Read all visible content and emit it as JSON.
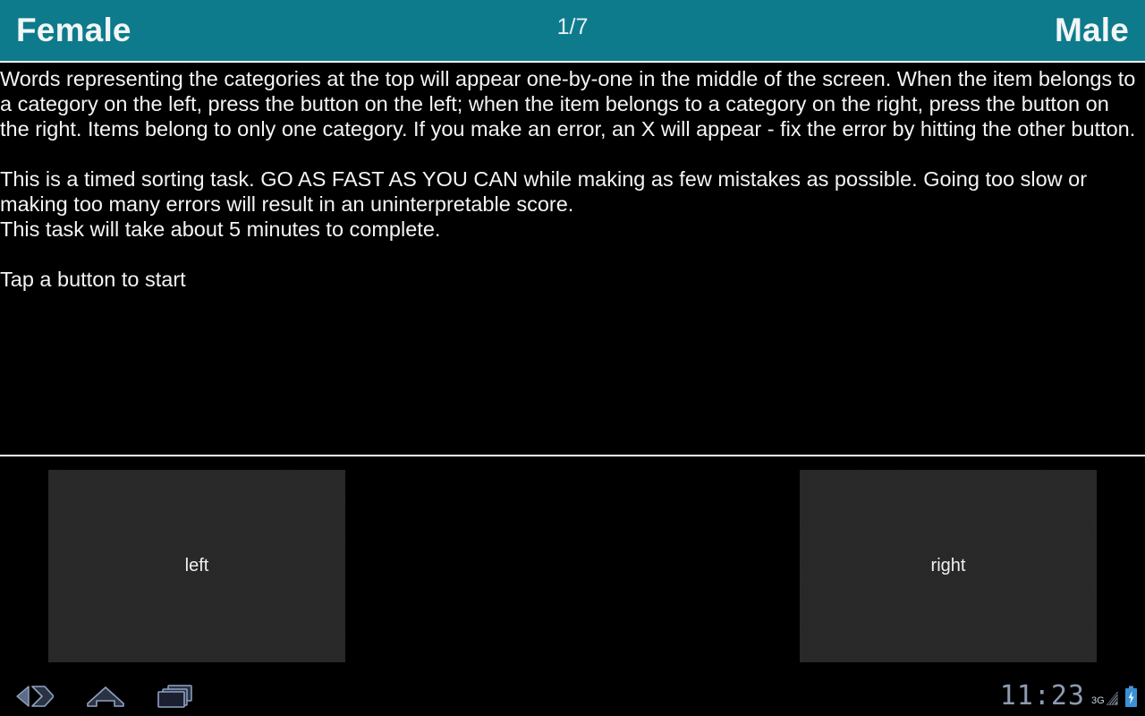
{
  "header": {
    "left_category": "Female",
    "counter": "1/7",
    "right_category": "Male"
  },
  "instructions": {
    "paragraph1": "Words representing the categories at the top will appear one-by-one in the middle of the screen. When the item belongs to a category on the left, press the button on the left; when the item belongs to a category on the right, press the button on the right. Items belong to only one category. If you make an error, an X will appear - fix the error by hitting the other button.",
    "paragraph2": "This is a timed sorting task. GO AS FAST AS YOU CAN while making as few mistakes as possible. Going too slow or making too many errors will result in an uninterpretable score.",
    "paragraph3": "This task will take about 5 minutes to complete.",
    "prompt": "Tap a button to start"
  },
  "buttons": {
    "left_label": "left",
    "right_label": "right"
  },
  "navbar": {
    "back_icon": "back-arrow-icon",
    "home_icon": "home-icon",
    "recents_icon": "recent-apps-icon"
  },
  "status": {
    "clock": "11:23",
    "network_label": "3G",
    "signal_icon": "signal-bars-icon",
    "battery_icon": "battery-charging-icon"
  },
  "colors": {
    "header_teal": "#0d7b8c",
    "background": "#000000",
    "button_fill": "#262626",
    "text": "#f4f4f4",
    "status_text": "#8e9bb0",
    "battery_blue": "#3b8fd4"
  }
}
